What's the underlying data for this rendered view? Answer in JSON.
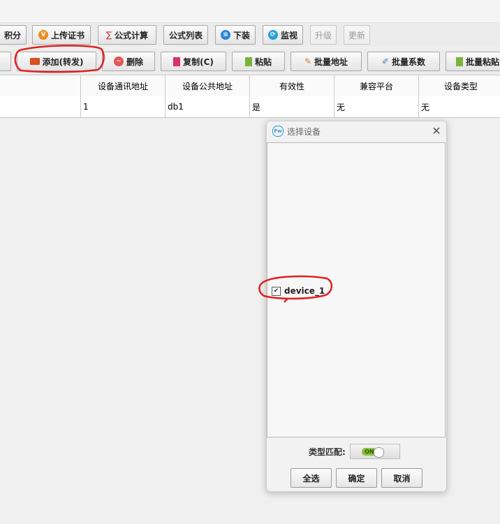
{
  "toolbar_top": {
    "points": "积分",
    "upload_cert": "上传证书",
    "formula_calc": "公式计算",
    "formula_list": "公式列表",
    "download": "下装",
    "monitor": "监视",
    "upgrade": "升级",
    "update": "更新"
  },
  "toolbar_second": {
    "add_forward": "添加(转发)",
    "delete": "删除",
    "copy": "复制(C)",
    "paste": "粘贴",
    "batch_address": "批量地址",
    "batch_coef": "批量系数",
    "batch_paste": "批量粘贴"
  },
  "table": {
    "columns": [
      "设备通讯地址",
      "设备公共地址",
      "有效性",
      "兼容平台",
      "设备类型"
    ],
    "rows": [
      [
        "1",
        "db1",
        "是",
        "无",
        "无"
      ]
    ]
  },
  "dialog": {
    "title": "选择设备",
    "logo": "Fw",
    "items": [
      {
        "label": "device_1",
        "checked": true
      }
    ],
    "type_match_label": "类型匹配:",
    "toggle_state": "ON",
    "select_all": "全选",
    "confirm": "确定",
    "cancel": "取消"
  },
  "colors": {
    "annotation": "#e02020",
    "toggle_on": "#8cbf3f",
    "accent": "#2a9fd8"
  }
}
